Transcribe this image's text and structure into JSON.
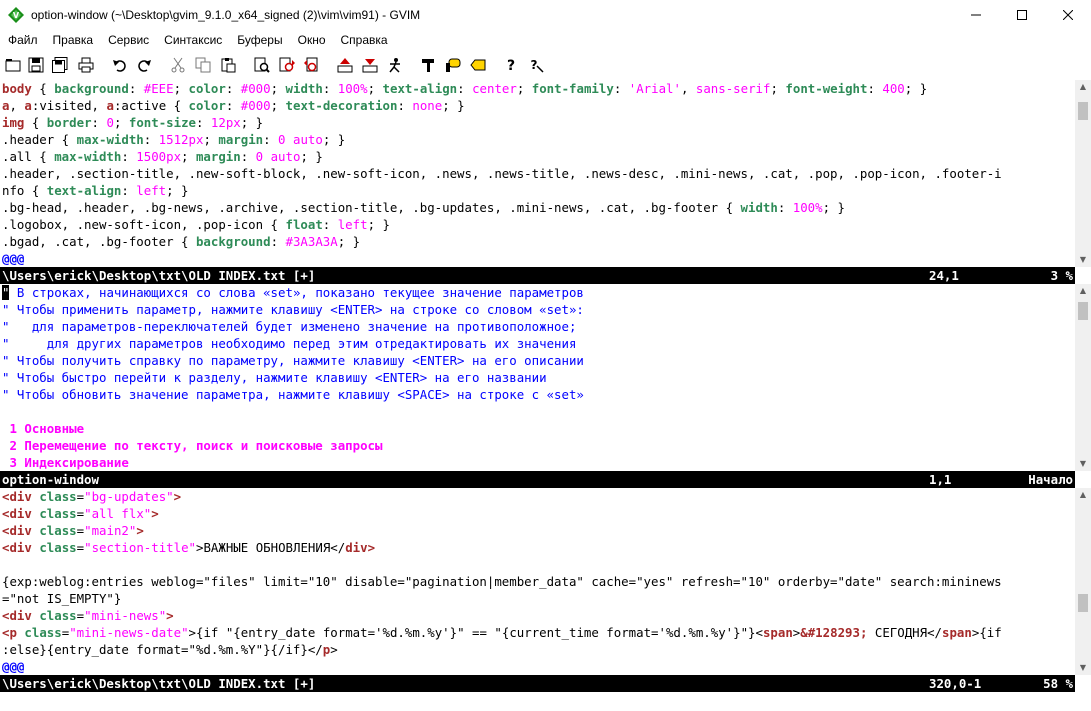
{
  "window": {
    "title": "option-window (~\\Desktop\\gvim_9.1.0_x64_signed (2)\\vim\\vim91) - GVIM",
    "icon": "gvim-icon"
  },
  "menu": [
    "Файл",
    "Правка",
    "Сервис",
    "Синтаксис",
    "Буферы",
    "Окно",
    "Справка"
  ],
  "toolbar": [
    "open-icon",
    "save-icon",
    "save-all-icon",
    "print-icon",
    "undo-icon",
    "redo-icon",
    "cut-icon",
    "copy-icon",
    "paste-icon",
    "find-replace-icon",
    "find-next-icon",
    "find-prev-icon",
    "load-session-icon",
    "save-session-icon",
    "run-script-icon",
    "make-icon",
    "shell-icon",
    "ctags-icon",
    "help-icon",
    "find-help-icon"
  ],
  "pane1": {
    "l1": [
      "body",
      " { ",
      "background",
      ": ",
      "#EEE",
      "; ",
      "color",
      ": ",
      "#000",
      "; ",
      "width",
      ": ",
      "100%",
      "; ",
      "text-align",
      ": ",
      "center",
      "; ",
      "font-family",
      ": ",
      "'Arial'",
      ", ",
      "sans-serif",
      "; ",
      "font-weight",
      ": ",
      "400",
      "; }"
    ],
    "l2": [
      "a",
      ", ",
      "a",
      ":visited, ",
      "a",
      ":active { ",
      "color",
      ": ",
      "#000",
      "; ",
      "text-decoration",
      ": ",
      "none",
      "; }"
    ],
    "l3": [
      "img",
      " { ",
      "border",
      ": ",
      "0",
      "; ",
      "font-size",
      ": ",
      "12px",
      "; }"
    ],
    "l4": [
      ".header { ",
      "max-width",
      ": ",
      "1512px",
      "; ",
      "margin",
      ": ",
      "0",
      " ",
      "auto",
      "; }"
    ],
    "l5": [
      ".all { ",
      "max-width",
      ": ",
      "1500px",
      "; ",
      "margin",
      ": ",
      "0",
      " ",
      "auto",
      "; }"
    ],
    "l6": ".header, .section-title, .new-soft-block, .new-soft-icon, .news, .news-title, .news-desc, .mini-news, .cat, .pop, .pop-icon, .footer-i",
    "l7": [
      "nfo { ",
      "text-align",
      ": ",
      "left",
      "; }"
    ],
    "l8": [
      ".bg-head, .header, .bg-news, .archive, .section-title, .bg-updates, .mini-news, .cat, .bg-footer { ",
      "width",
      ": ",
      "100%",
      "; }"
    ],
    "l9": [
      ".logobox, .new-soft-icon, .pop-icon { ",
      "float",
      ": ",
      "left",
      "; }"
    ],
    "l10": [
      ".bgad, .cat, .bg-footer { ",
      "background",
      ": ",
      "#3A3A3A",
      "; }"
    ],
    "l11": "@@@"
  },
  "status1": {
    "file": "\\Users\\erick\\Desktop\\txt\\OLD INDEX.txt [+]",
    "pos": "24,1",
    "pct": "3 %"
  },
  "pane2": {
    "l1_cursor": "\"",
    "l1": " В строках, начинающихся со слова «set», показано текущее значение параметров",
    "l2": "\" Чтобы применить параметр, нажмите клавишу <ENTER> на строке со словом «set»:",
    "l3": "\"   для параметров-переключателей будет изменено значение на противоположное;",
    "l4": "\"     для других параметров необходимо перед этим отредактировать их значения",
    "l5": "\" Чтобы получить справку по параметру, нажмите клавишу <ENTER> на его описании",
    "l6": "\" Чтобы быстро перейти к разделу, нажмите клавишу <ENTER> на его названии",
    "l7": "\" Чтобы обновить значение параметра, нажмите клавишу <SPACE> на строке с «set»",
    "s1": " 1 Основные",
    "s2": " 2 Перемещение по тексту, поиск и поисковые запросы",
    "s3": " 3 Индексирование"
  },
  "status2": {
    "file": "option-window",
    "pos": "1,1",
    "pct": "Начало"
  },
  "pane3": {
    "l1": [
      "<",
      "div",
      " ",
      "class",
      "=",
      "\"bg-updates\"",
      ">"
    ],
    "l2": [
      "<",
      "div",
      " ",
      "class",
      "=",
      "\"all flx\"",
      ">"
    ],
    "l3": [
      "<",
      "div",
      " ",
      "class",
      "=",
      "\"main2\"",
      ">"
    ],
    "l4": [
      "<",
      "div",
      " ",
      "class",
      "=",
      "\"section-title\"",
      ">ВАЖНЫЕ ОБНОВЛЕНИЯ</",
      "div",
      ">"
    ],
    "l6": "{exp:weblog:entries weblog=\"files\" limit=\"10\" disable=\"pagination|member_data\" cache=\"yes\" refresh=\"10\" orderby=\"date\" search:mininews",
    "l7": "=\"not IS_EMPTY\"}",
    "l8": [
      "<",
      "div",
      " ",
      "class",
      "=",
      "\"mini-news\"",
      ">"
    ],
    "l9": [
      "<",
      "p",
      " ",
      "class",
      "=",
      "\"mini-news-date\"",
      ">{if \"{entry_date format='%d.%m.%y'}\" == \"{current_time format='%d.%m.%y'}\"}<",
      "span",
      ">",
      "&#128293;",
      " СЕГОДНЯ</",
      "span",
      ">{if"
    ],
    "l10": [
      ":else}{entry_date format=\"%d.%m.%Y\"}{/if}</",
      "p",
      ">"
    ],
    "l11": "@@@"
  },
  "status3": {
    "file": "\\Users\\erick\\Desktop\\txt\\OLD INDEX.txt [+]",
    "pos": "320,0-1",
    "pct": "58 %"
  }
}
